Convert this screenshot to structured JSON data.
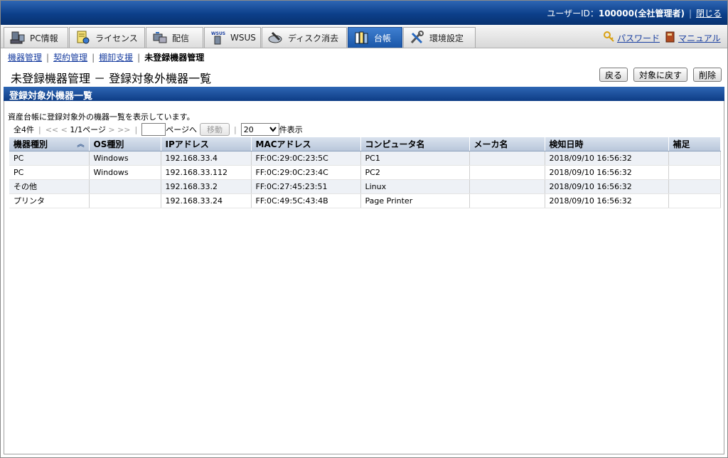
{
  "header": {
    "user_label": "ユーザーID：",
    "user_value": "100000(全社管理者)",
    "close_link": "閉じる"
  },
  "tabs": [
    {
      "label": "PC情報",
      "icon": "pc-icon"
    },
    {
      "label": "ライセンス",
      "icon": "license-icon"
    },
    {
      "label": "配信",
      "icon": "delivery-icon"
    },
    {
      "label": "WSUS",
      "icon": "wsus-icon"
    },
    {
      "label": "ディスク消去",
      "icon": "disk-erase-icon"
    },
    {
      "label": "台帳",
      "icon": "ledger-icon",
      "active": true
    },
    {
      "label": "環境設定",
      "icon": "tools-icon"
    }
  ],
  "tab_links": {
    "password": "パスワード",
    "manual": "マニュアル"
  },
  "breadcrumb": {
    "items": [
      "機器管理",
      "契約管理",
      "棚卸支援"
    ],
    "current": "未登録機器管理"
  },
  "page": {
    "title": "未登録機器管理 － 登録対象外機器一覧",
    "buttons": {
      "back": "戻る",
      "restore": "対象に戻す",
      "delete": "削除"
    }
  },
  "section_title": "登録対象外機器一覧",
  "description": "資産台帳に登録対象外の機器一覧を表示しています。",
  "pager": {
    "total": "全4件",
    "first": "<<",
    "prev": "<",
    "page_info": "1/1ページ",
    "next": ">",
    "last": ">>",
    "page_input": "",
    "page_suffix": "ページへ",
    "move": "移動",
    "per_page": "20",
    "per_page_suffix": "件表示"
  },
  "table": {
    "columns": [
      "機器種別",
      "OS種別",
      "IPアドレス",
      "MACアドレス",
      "コンピュータ名",
      "メーカ名",
      "検知日時",
      "補足"
    ],
    "rows": [
      [
        "PC",
        "Windows",
        "192.168.33.4",
        "FF:0C:29:0C:23:5C",
        "PC1",
        "",
        "2018/09/10 16:56:32",
        ""
      ],
      [
        "PC",
        "Windows",
        "192.168.33.112",
        "FF:0C:29:0C:23:4C",
        "PC2",
        "",
        "2018/09/10 16:56:32",
        ""
      ],
      [
        "その他",
        "",
        "192.168.33.2",
        "FF:0C:27:45:23:51",
        "Linux",
        "",
        "2018/09/10 16:56:32",
        ""
      ],
      [
        "プリンタ",
        "",
        "192.168.33.24",
        "FF:0C:49:5C:43:4B",
        "Page Printer",
        "",
        "2018/09/10 16:56:32",
        ""
      ]
    ]
  }
}
